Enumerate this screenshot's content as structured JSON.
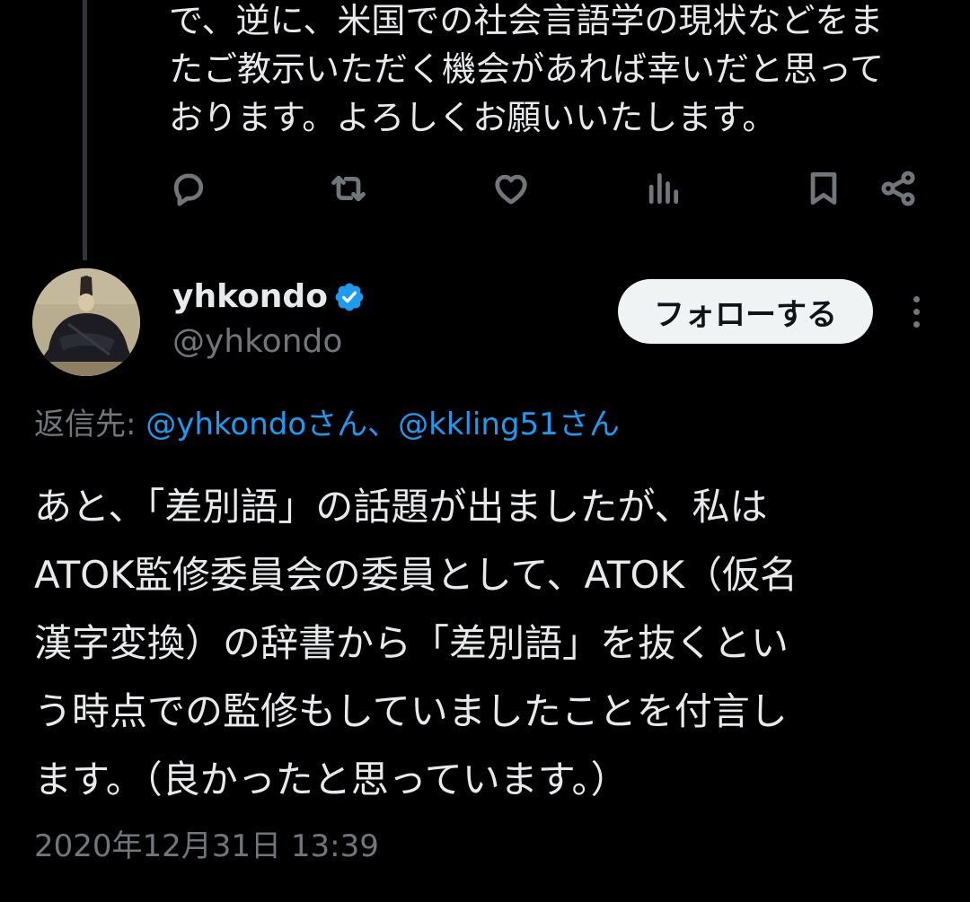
{
  "previous_tweet": {
    "text": "で、逆に、米国での社会言語学の現状などをま\nたご教示いただく機会があれば幸いだと思って\nおります。よろしくお願いいたします。",
    "actions": {
      "reply_icon": "reply-icon",
      "retweet_icon": "retweet-icon",
      "like_icon": "like-icon",
      "views_icon": "views-icon",
      "bookmark_icon": "bookmark-icon",
      "share_icon": "share-icon"
    }
  },
  "tweet": {
    "display_name": "yhkondo",
    "handle": "@yhkondo",
    "verified": true,
    "verified_color": "#1d9bf0",
    "follow_label": "フォローする",
    "replying_to": {
      "prefix": "返信先: ",
      "mentions": "@yhkondoさん、@kkling51さん"
    },
    "text": "あと、「差別語」の話題が出ましたが、私は\nATOK監修委員会の委員として、ATOK（仮名\n漢字変換）の辞書から「差別語」を抜くとい\nう時点での監修もしていましたことを付言し\nます。（良かったと思っています。）",
    "timestamp": "2020年12月31日 13:39"
  },
  "colors": {
    "background": "#000000",
    "text_primary": "#e7e9ea",
    "text_secondary": "#71767b",
    "link": "#1d9bf0",
    "follow_button_bg": "#eff3f4",
    "follow_button_text": "#0f1419"
  }
}
